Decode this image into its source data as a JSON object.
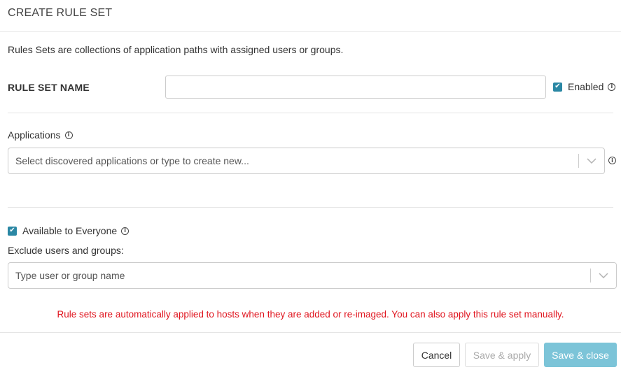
{
  "dialog": {
    "title": "CREATE RULE SET",
    "description": "Rules Sets are collections of application paths with assigned users or groups."
  },
  "rule_set_name": {
    "label": "RULE SET NAME",
    "value": "",
    "enabled_label": "Enabled",
    "enabled_checked": true
  },
  "applications": {
    "label": "Applications",
    "placeholder": "Select discovered applications or type to create new..."
  },
  "access": {
    "available_label": "Available to Everyone",
    "available_checked": true,
    "exclude_label": "Exclude users and groups:",
    "exclude_placeholder": "Type user or group name"
  },
  "warning": "Rule sets are automatically applied to hosts when they are added or re-imaged. You can also apply this rule set manually.",
  "footer": {
    "cancel_label": "Cancel",
    "save_apply_label": "Save & apply",
    "save_close_label": "Save & close"
  },
  "icons": {
    "info": "info-icon",
    "checkbox": "checkmark-icon",
    "dropdown": "chevron-down-icon"
  },
  "colors": {
    "accent": "#2a87a4",
    "primary_button": "#7cc4d8",
    "warning_text": "#e0141e"
  }
}
